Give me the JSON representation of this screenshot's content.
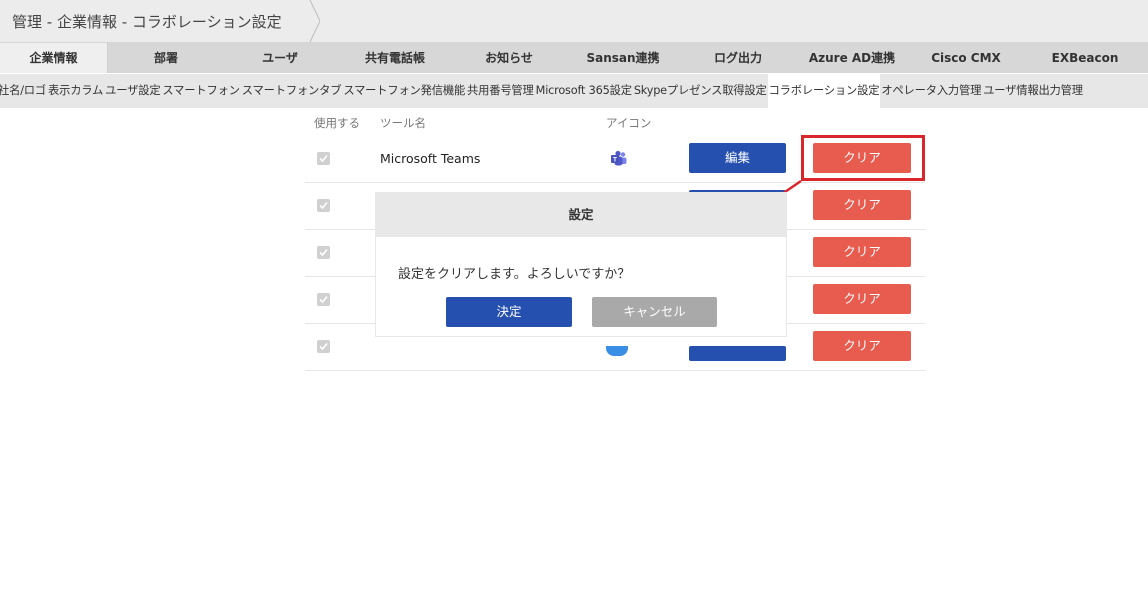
{
  "header": {
    "breadcrumb": "管理 - 企業情報 - コラボレーション設定"
  },
  "tabs": [
    {
      "label": "企業情報",
      "active": true
    },
    {
      "label": "部署"
    },
    {
      "label": "ユーザ"
    },
    {
      "label": "共有電話帳"
    },
    {
      "label": "お知らせ"
    },
    {
      "label": "Sansan連携"
    },
    {
      "label": "ログ出力"
    },
    {
      "label": "Azure AD連携"
    },
    {
      "label": "Cisco CMX"
    },
    {
      "label": "EXBeacon"
    }
  ],
  "subtabs": [
    {
      "label": "社名/ロゴ"
    },
    {
      "label": "表示カラム"
    },
    {
      "label": "ユーザ設定"
    },
    {
      "label": "スマートフォン"
    },
    {
      "label": "スマートフォンタブ"
    },
    {
      "label": "スマートフォン発信機能"
    },
    {
      "label": "共用番号管理"
    },
    {
      "label": "Microsoft 365設定"
    },
    {
      "label": "Skypeプレゼンス取得設定"
    },
    {
      "label": "コラボレーション設定",
      "active": true
    },
    {
      "label": "オペレータ入力管理"
    },
    {
      "label": "ユーザ情報出力管理"
    }
  ],
  "table": {
    "headers": {
      "use": "使用する",
      "tool": "ツール名",
      "icon": "アイコン"
    },
    "rows": [
      {
        "name": "Microsoft Teams",
        "icon": "microsoft-teams-icon",
        "edit": "編集",
        "clear": "クリア"
      },
      {
        "name": "",
        "edit": "",
        "clear": "クリア"
      },
      {
        "name": "",
        "edit": "",
        "clear": "クリア"
      },
      {
        "name": "",
        "edit": "",
        "clear": "クリア"
      },
      {
        "name": "",
        "edit": "",
        "clear": "クリア"
      }
    ]
  },
  "dialog": {
    "title": "設定",
    "message": "設定をクリアします。よろしいですか？",
    "ok": "決定",
    "cancel": "キャンセル"
  },
  "colors": {
    "primary": "#2650b0",
    "danger": "#e85c4f",
    "annotation": "#d8262c"
  }
}
